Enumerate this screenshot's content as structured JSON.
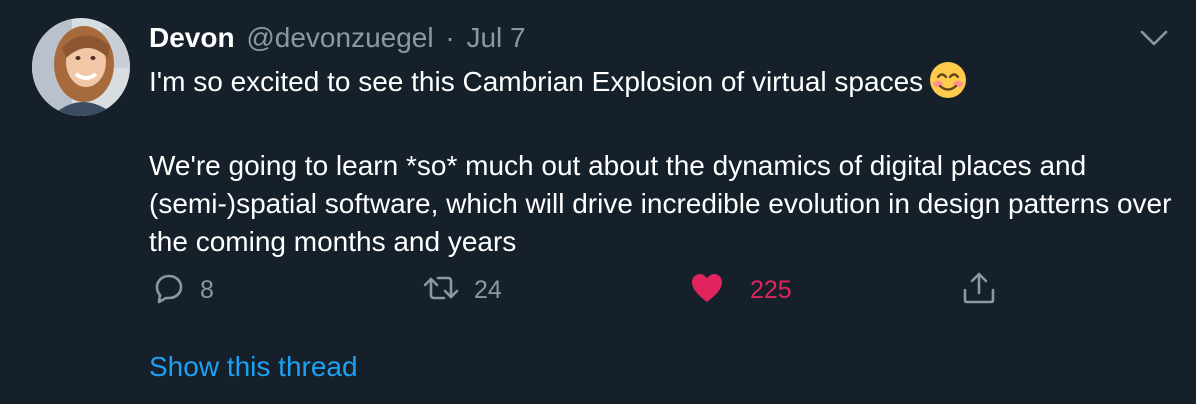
{
  "tweet": {
    "author_name": "Devon",
    "handle": "@devonzuegel",
    "separator": "·",
    "date": "Jul 7",
    "text_paragraphs": [
      "I'm so excited to see this Cambrian Explosion of virtual spaces",
      "We're going to learn *so* much out about the dynamics of digital places and (semi-)spatial software, which will drive incredible evolution in design patterns over the coming months and years"
    ],
    "emoji": "smiling-face-with-smiling-eyes"
  },
  "actions": {
    "reply_count": "8",
    "retweet_count": "24",
    "like_count": "225"
  },
  "show_thread_label": "Show this thread",
  "colors": {
    "background": "#15202b",
    "secondary_text": "#8899a6",
    "link": "#1da1f2",
    "like": "#e0245e"
  },
  "icons": [
    "caret-down-icon",
    "reply-icon",
    "retweet-icon",
    "heart-icon",
    "share-icon"
  ]
}
